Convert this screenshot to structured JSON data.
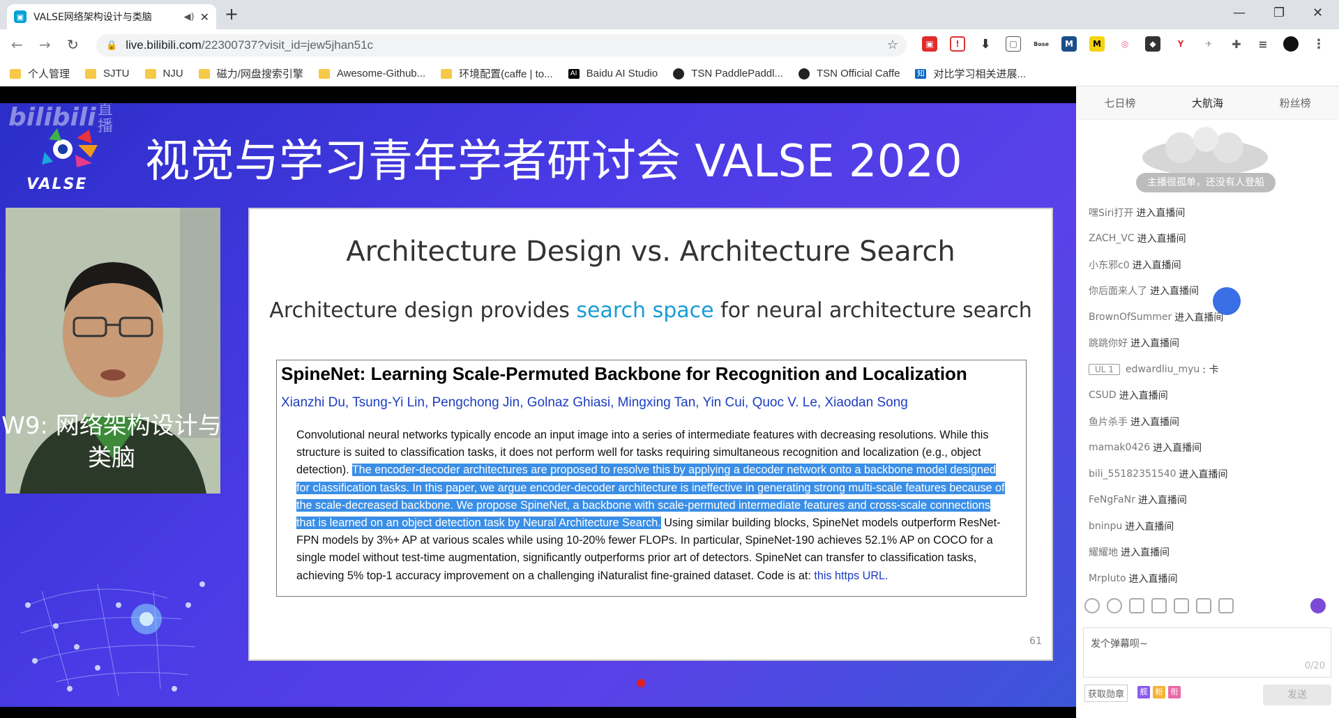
{
  "browser": {
    "tab_title": "VALSE网络架构设计与类脑",
    "url_host": "live.bilibili.com",
    "url_path": "/22300737?visit_id=jew5jhan51c",
    "bookmarks": [
      {
        "label": "个人管理",
        "icon": "folder-icon"
      },
      {
        "label": "SJTU",
        "icon": "folder-icon"
      },
      {
        "label": "NJU",
        "icon": "folder-icon"
      },
      {
        "label": "磁力/网盘搜索引擎",
        "icon": "folder-icon"
      },
      {
        "label": "Awesome-Github...",
        "icon": "folder-icon"
      },
      {
        "label": "环境配置(caffe | to...",
        "icon": "folder-icon"
      },
      {
        "label": "Baidu AI Studio",
        "icon": "ai-icon"
      },
      {
        "label": "TSN PaddlePaddl...",
        "icon": "github-icon"
      },
      {
        "label": "TSN Official Caffe",
        "icon": "github-icon"
      },
      {
        "label": "对比学习相关进展...",
        "icon": "zhihu-icon"
      }
    ]
  },
  "video": {
    "watermark": "bilibili",
    "watermark_live": "直播",
    "logo_text": "VALSE",
    "conference_title": "视觉与学习青年学者研讨会 VALSE 2020",
    "session_title": "W9: 网络架构设计与类脑"
  },
  "slide": {
    "heading": "Architecture Design vs. Architecture Search",
    "subtitle_pre": "Architecture design provides ",
    "subtitle_hl": "search space",
    "subtitle_post": " for neural architecture search",
    "paper_title": "SpineNet: Learning Scale-Permuted Backbone for Recognition and Localization",
    "authors": "Xianzhi Du, Tsung-Yi Lin, Pengchong Jin, Golnaz Ghiasi, Mingxing Tan, Yin Cui, Quoc V. Le, Xiaodan Song",
    "abstract_a": "Convolutional neural networks typically encode an input image into a series of intermediate features with decreasing resolutions. While this structure is suited to classification tasks, it does not perform well for tasks requiring simultaneous recognition and localization (e.g., object detection). ",
    "abstract_selected": "The encoder-decoder architectures are proposed to resolve this by applying a decoder network onto a backbone model designed for classification tasks. In this paper, we argue encoder-decoder architecture is ineffective in generating strong multi-scale features because of the scale-decreased backbone. We propose SpineNet, a backbone with scale-permuted intermediate features and cross-scale connections that is learned on an object detection task by Neural Architecture Search.",
    "abstract_b": " Using similar building blocks, SpineNet models outperform ResNet-FPN models by 3%+ AP at various scales while using 10-20% fewer FLOPs. In particular, SpineNet-190 achieves 52.1% AP on COCO for a single model without test-time augmentation, significantly outperforms prior art of detectors. SpineNet can transfer to classification tasks, achieving 5% top-1 accuracy improvement on a challenging iNaturalist fine-grained dataset. Code is at: ",
    "abstract_link": "this https URL.",
    "page_number": "61"
  },
  "panel": {
    "tabs": [
      "七日榜",
      "大航海",
      "粉丝榜"
    ],
    "empty_text": "主播很孤单，还没有人登船",
    "messages": [
      {
        "user": "嘿Siri打开",
        "text": "进入直播间"
      },
      {
        "user": "ZACH_VC",
        "text": "进入直播间"
      },
      {
        "user": "小东邪c0",
        "text": "进入直播间"
      },
      {
        "user": "你后面来人了",
        "text": "进入直播间"
      },
      {
        "user": "BrownOfSummer",
        "text": "进入直播间"
      },
      {
        "user": "跳跳你好",
        "text": "进入直播间"
      },
      {
        "badge": "UL 1",
        "user": "edwardliu_myu",
        "text": ": 卡"
      },
      {
        "user": "CSUD",
        "text": "进入直播间"
      },
      {
        "user": "鱼片杀手",
        "text": "进入直播间"
      },
      {
        "user": "mamak0426",
        "text": "进入直播间"
      },
      {
        "user": "bili_55182351540",
        "text": "进入直播间"
      },
      {
        "user": "FeNgFaNr",
        "text": "进入直播间"
      },
      {
        "user": "bninpu",
        "text": "进入直播间"
      },
      {
        "user": "耀耀地",
        "text": "进入直播间"
      },
      {
        "user": "Mrpluto",
        "text": "进入直播间"
      }
    ],
    "input_placeholder": "发个弹幕呗~",
    "input_count": "0/20",
    "medal_label": "获取勋章",
    "medal_btns": [
      "舰",
      "粉",
      "衔"
    ],
    "send_label": "发送"
  }
}
